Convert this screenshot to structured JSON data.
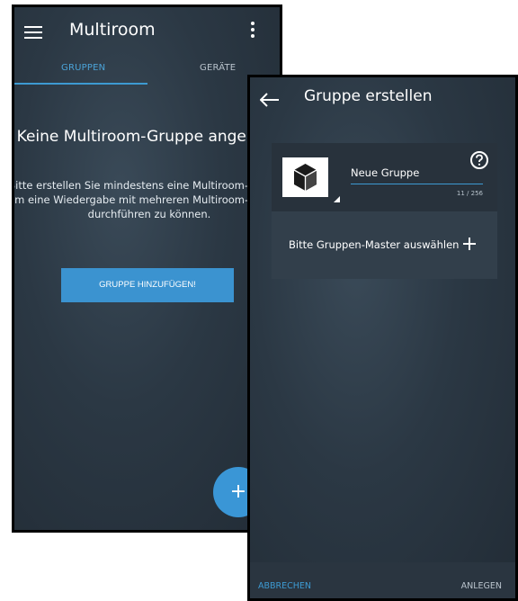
{
  "left_screen": {
    "appbar": {
      "title": "Multiroom",
      "menu_icon": "hamburger-icon",
      "overflow_icon": "more-vert-icon"
    },
    "tabs": [
      {
        "label": "GRUPPEN",
        "active": true
      },
      {
        "label": "GERÄTE",
        "active": false
      }
    ],
    "empty_state": {
      "title": "Keine Multiroom-Gruppe angelegt!",
      "message": "Bitte erstellen Sie mindestens eine Multiroom-Gruppe, um eine Wiedergabe mit mehreren Multiroom-Geräten durchführen zu können.",
      "button_label": "GRUPPE HINZUFÜGEN!"
    },
    "fab": {
      "label": "+",
      "icon": "add-icon"
    }
  },
  "right_screen": {
    "appbar": {
      "title": "Gruppe erstellen",
      "back_icon": "arrow-back-icon"
    },
    "group_card": {
      "name_value": "Neue Gruppe",
      "char_counter": "11 / 256",
      "help_icon": "help-circle-icon",
      "logo_icon": "speaker-cube-icon",
      "master_label": "Bitte Gruppen-Master auswählen",
      "add_master_icon": "plus-icon"
    },
    "bottom_bar": {
      "cancel_label": "ABBRECHEN",
      "confirm_label": "ANLEGEN"
    }
  },
  "colors": {
    "accent": "#3b93d0",
    "background": "#2b3844",
    "card": "#323f4b"
  }
}
